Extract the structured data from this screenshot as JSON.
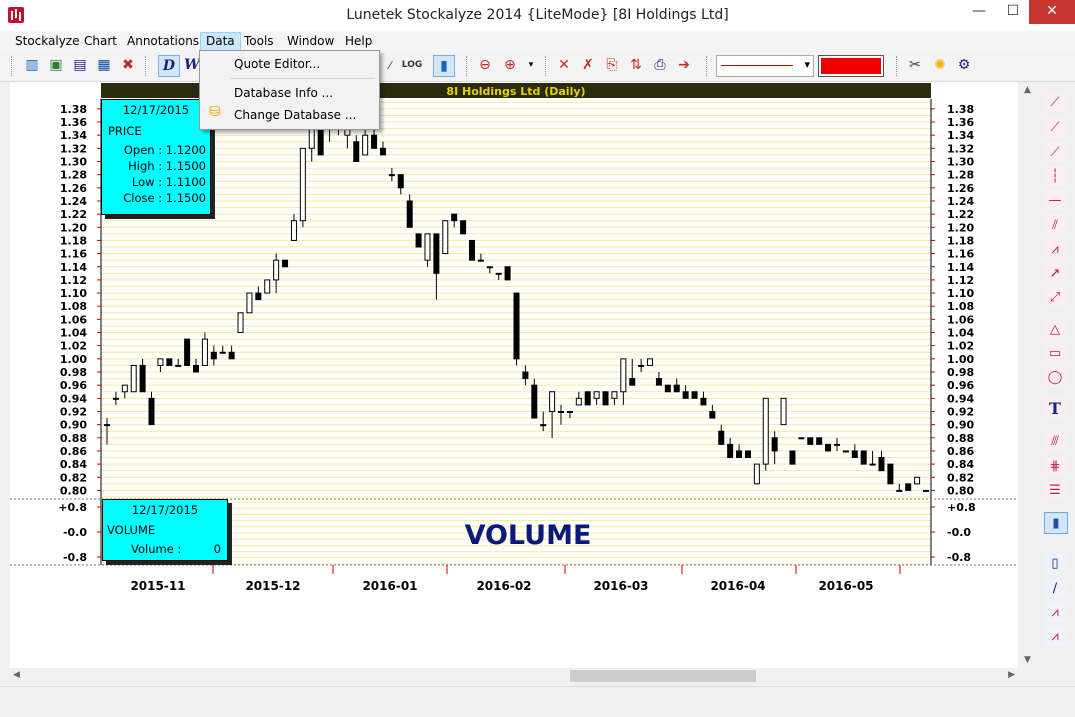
{
  "window": {
    "title": "Lunetek Stockalyze 2014 {LiteMode} [8I Holdings Ltd]",
    "min": "—",
    "max": "☐",
    "close": "✕"
  },
  "menu": [
    "Stockalyze",
    "Chart",
    "Annotations",
    "Data",
    "Tools",
    "Window",
    "Help"
  ],
  "data_menu": {
    "quote_editor": "Quote Editor...",
    "database_info": "Database Info ...",
    "change_database": "Change Database ..."
  },
  "chart_header": "8I Holdings Ltd (Daily)",
  "price_box": {
    "date": "12/17/2015",
    "title": "PRICE",
    "open": "Open : 1.1200",
    "high": "High : 1.1500",
    "low": "Low : 1.1100",
    "close": "Close : 1.1500"
  },
  "volume_box": {
    "date": "12/17/2015",
    "title": "VOLUME",
    "volume_label": "Volume :",
    "volume_value": "0"
  },
  "volume_watermark": "VOLUME",
  "colors": {
    "accent": "#ee0000",
    "header_bg": "#2b2b10",
    "header_text": "#e8d000",
    "info_bg": "#00ffff",
    "grid": "#f1ec9a",
    "watermark": "#0a1a7a"
  },
  "chart_data": {
    "type": "candlestick",
    "title": "8I Holdings Ltd (Daily)",
    "ylim": [
      0.79,
      1.395
    ],
    "y_ticks": [
      1.38,
      1.36,
      1.34,
      1.32,
      1.3,
      1.28,
      1.26,
      1.24,
      1.22,
      1.2,
      1.18,
      1.16,
      1.14,
      1.12,
      1.1,
      1.08,
      1.06,
      1.04,
      1.02,
      1.0,
      0.98,
      0.96,
      0.94,
      0.92,
      0.9,
      0.88,
      0.86,
      0.84,
      0.82,
      0.8
    ],
    "y_tick_labels": [
      "1.38",
      "1.36",
      "1.34",
      "1.32",
      "1.30",
      "1.28",
      "1.26",
      "1.24",
      "1.22",
      "1.20",
      "1.18",
      "1.16",
      "1.14",
      "1.12",
      "1.10",
      "1.08",
      "1.06",
      "1.04",
      "1.02",
      "1.00",
      "0.98",
      "0.96",
      "0.94",
      "0.92",
      "0.90",
      "0.88",
      "0.86",
      "0.84",
      "0.82",
      "0.80"
    ],
    "x_labels": [
      "2015-11",
      "2015-12",
      "2016-01",
      "2016-02",
      "2016-03",
      "2016-04",
      "2016-05"
    ],
    "volume_ticks": [
      "+0.8",
      "-0.0",
      "-0.8"
    ],
    "candles": [
      [
        0.9,
        0.91,
        0.87,
        0.9
      ],
      [
        0.94,
        0.95,
        0.93,
        0.94
      ],
      [
        0.95,
        0.96,
        0.94,
        0.96
      ],
      [
        0.95,
        0.99,
        0.95,
        0.99
      ],
      [
        0.99,
        1.0,
        0.95,
        0.95
      ],
      [
        0.94,
        0.95,
        0.9,
        0.9
      ],
      [
        0.99,
        1.0,
        0.98,
        1.0
      ],
      [
        1.0,
        1.0,
        0.99,
        0.99
      ],
      [
        0.99,
        1.0,
        0.99,
        0.99
      ],
      [
        1.03,
        1.03,
        0.99,
        0.99
      ],
      [
        0.99,
        1.0,
        0.98,
        0.98
      ],
      [
        0.99,
        1.04,
        0.99,
        1.03
      ],
      [
        1.01,
        1.02,
        0.99,
        1.0
      ],
      [
        1.01,
        1.02,
        1.01,
        1.01
      ],
      [
        1.01,
        1.02,
        1.0,
        1.0
      ],
      [
        1.04,
        1.07,
        1.04,
        1.07
      ],
      [
        1.07,
        1.1,
        1.07,
        1.1
      ],
      [
        1.1,
        1.11,
        1.09,
        1.09
      ],
      [
        1.1,
        1.12,
        1.1,
        1.12
      ],
      [
        1.12,
        1.16,
        1.1,
        1.15
      ],
      [
        1.15,
        1.15,
        1.14,
        1.14
      ],
      [
        1.18,
        1.22,
        1.18,
        1.21
      ],
      [
        1.21,
        1.32,
        1.2,
        1.32
      ],
      [
        1.32,
        1.38,
        1.3,
        1.36
      ],
      [
        1.36,
        1.38,
        1.31,
        1.31
      ],
      [
        1.35,
        1.38,
        1.33,
        1.36
      ],
      [
        1.35,
        1.37,
        1.34,
        1.36
      ],
      [
        1.34,
        1.37,
        1.32,
        1.37
      ],
      [
        1.33,
        1.34,
        1.3,
        1.3
      ],
      [
        1.31,
        1.36,
        1.31,
        1.34
      ],
      [
        1.34,
        1.35,
        1.32,
        1.32
      ],
      [
        1.32,
        1.33,
        1.31,
        1.31
      ],
      [
        1.28,
        1.29,
        1.27,
        1.28
      ],
      [
        1.28,
        1.28,
        1.25,
        1.26
      ],
      [
        1.24,
        1.25,
        1.2,
        1.2
      ],
      [
        1.19,
        1.19,
        1.17,
        1.17
      ],
      [
        1.15,
        1.19,
        1.14,
        1.19
      ],
      [
        1.19,
        1.19,
        1.09,
        1.13
      ],
      [
        1.16,
        1.21,
        1.16,
        1.21
      ],
      [
        1.22,
        1.22,
        1.2,
        1.21
      ],
      [
        1.21,
        1.21,
        1.19,
        1.19
      ],
      [
        1.18,
        1.18,
        1.15,
        1.15
      ],
      [
        1.15,
        1.16,
        1.15,
        1.15
      ],
      [
        1.14,
        1.14,
        1.13,
        1.14
      ],
      [
        1.13,
        1.13,
        1.12,
        1.13
      ],
      [
        1.14,
        1.14,
        1.12,
        1.12
      ],
      [
        1.1,
        1.1,
        0.99,
        1.0
      ],
      [
        0.98,
        0.99,
        0.96,
        0.97
      ],
      [
        0.96,
        0.97,
        0.91,
        0.91
      ],
      [
        0.9,
        0.92,
        0.89,
        0.9
      ],
      [
        0.92,
        0.95,
        0.88,
        0.95
      ],
      [
        0.92,
        0.93,
        0.9,
        0.92
      ],
      [
        0.92,
        0.92,
        0.91,
        0.92
      ],
      [
        0.93,
        0.95,
        0.93,
        0.94
      ],
      [
        0.95,
        0.95,
        0.93,
        0.93
      ],
      [
        0.94,
        0.95,
        0.93,
        0.95
      ],
      [
        0.95,
        0.95,
        0.93,
        0.93
      ],
      [
        0.94,
        0.95,
        0.93,
        0.95
      ],
      [
        0.95,
        1.0,
        0.93,
        1.0
      ],
      [
        0.97,
        1.0,
        0.96,
        0.96
      ],
      [
        0.99,
        1.0,
        0.98,
        0.99
      ],
      [
        0.99,
        1.0,
        0.99,
        1.0
      ],
      [
        0.97,
        0.98,
        0.96,
        0.96
      ],
      [
        0.96,
        0.96,
        0.95,
        0.95
      ],
      [
        0.96,
        0.97,
        0.95,
        0.95
      ],
      [
        0.95,
        0.96,
        0.94,
        0.94
      ],
      [
        0.95,
        0.95,
        0.94,
        0.94
      ],
      [
        0.94,
        0.95,
        0.93,
        0.93
      ],
      [
        0.92,
        0.93,
        0.91,
        0.91
      ],
      [
        0.89,
        0.9,
        0.87,
        0.87
      ],
      [
        0.87,
        0.88,
        0.85,
        0.85
      ],
      [
        0.86,
        0.87,
        0.85,
        0.85
      ],
      [
        0.86,
        0.86,
        0.85,
        0.85
      ],
      [
        0.81,
        0.84,
        0.81,
        0.84
      ],
      [
        0.84,
        0.94,
        0.83,
        0.94
      ],
      [
        0.88,
        0.89,
        0.84,
        0.86
      ],
      [
        0.9,
        0.94,
        0.9,
        0.94
      ],
      [
        0.86,
        0.86,
        0.84,
        0.84
      ],
      [
        0.88,
        0.88,
        0.88,
        0.88
      ],
      [
        0.88,
        0.88,
        0.87,
        0.87
      ],
      [
        0.88,
        0.88,
        0.87,
        0.87
      ],
      [
        0.87,
        0.87,
        0.86,
        0.86
      ],
      [
        0.87,
        0.88,
        0.86,
        0.87
      ],
      [
        0.86,
        0.86,
        0.86,
        0.86
      ],
      [
        0.86,
        0.87,
        0.85,
        0.85
      ],
      [
        0.86,
        0.86,
        0.84,
        0.84
      ],
      [
        0.84,
        0.86,
        0.84,
        0.84
      ],
      [
        0.85,
        0.86,
        0.83,
        0.83
      ],
      [
        0.84,
        0.84,
        0.81,
        0.81
      ],
      [
        0.8,
        0.81,
        0.8,
        0.8
      ],
      [
        0.81,
        0.81,
        0.8,
        0.8
      ],
      [
        0.81,
        0.82,
        0.81,
        0.82
      ],
      [
        0.8,
        0.8,
        0.8,
        0.8
      ]
    ]
  }
}
